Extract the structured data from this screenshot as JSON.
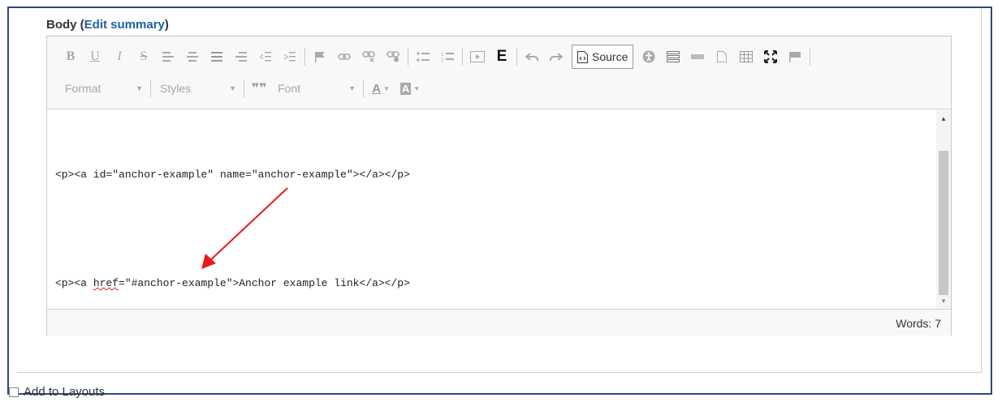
{
  "field": {
    "label": "Body",
    "open_paren": "(",
    "edit_summary_link": "Edit summary",
    "close_paren": ")"
  },
  "toolbar": {
    "row1": {
      "bold": "B",
      "underline": "U",
      "italic": "I",
      "strike": "S",
      "e_button": "E",
      "source_label": "Source"
    },
    "row2": {
      "format": "Format",
      "styles": "Styles",
      "blockquote": "❞❞",
      "font": "Font",
      "text_color": "A",
      "bg_color": "A"
    }
  },
  "editor": {
    "line1": "<p><a id=\"anchor-example\" name=\"anchor-example\"></a></p>",
    "line2_prefix": "<p><a ",
    "line2_href": "href",
    "line2_suffix": "=\"#anchor-example\">Anchor example link</a></p>",
    "annotation_color": "#e8191a"
  },
  "status": {
    "words": "Words: 7"
  },
  "below": {
    "add_to_layouts": "Add to Layouts"
  }
}
